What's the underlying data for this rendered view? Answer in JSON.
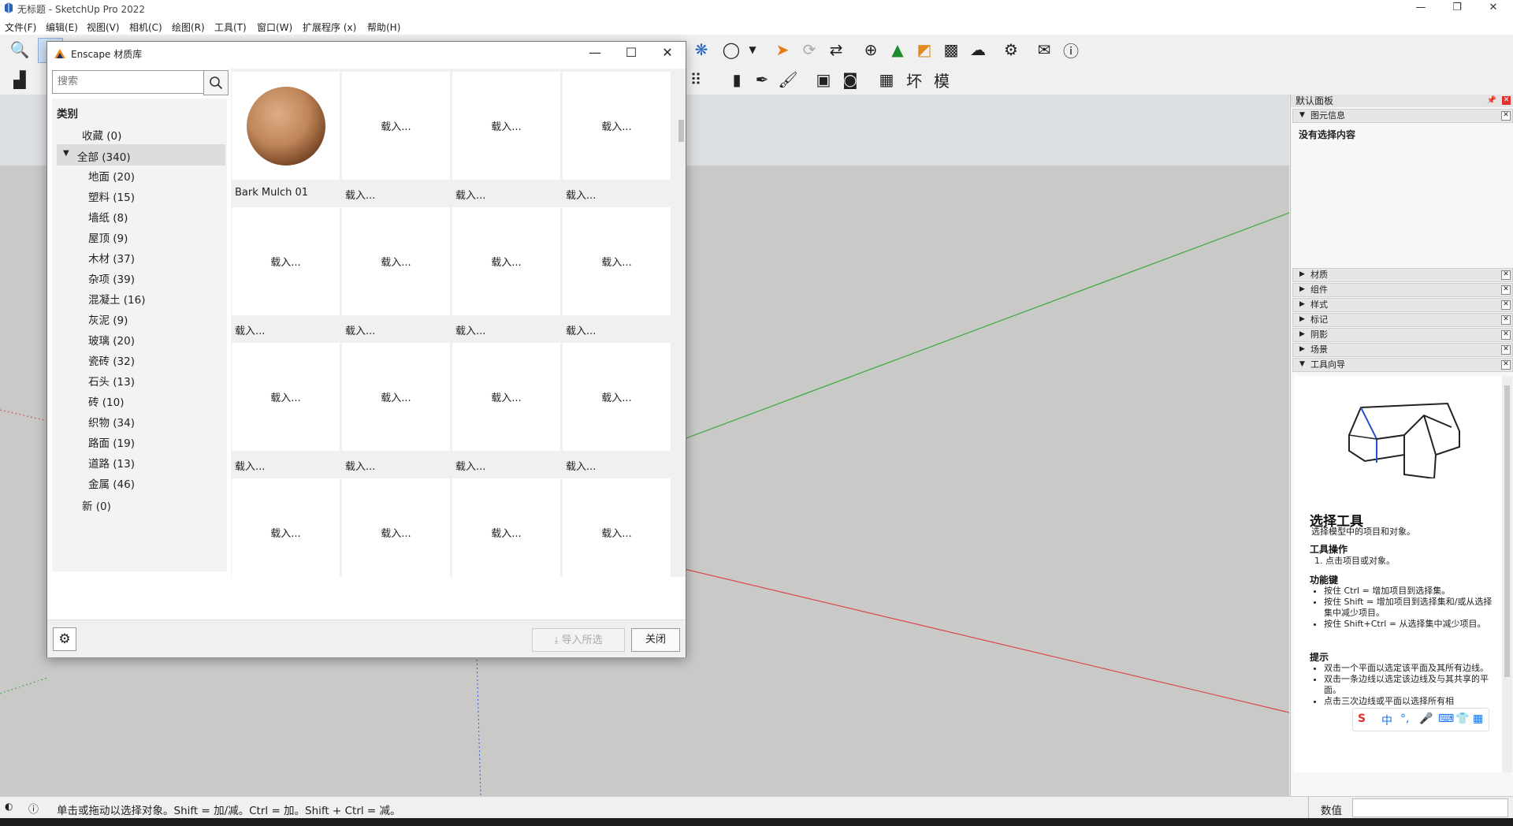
{
  "app": {
    "title": "无标题 - SketchUp Pro 2022",
    "window_controls": {
      "minimize": "—",
      "restore": "❐",
      "close": "✕"
    }
  },
  "menu": [
    "文件(F)",
    "编辑(E)",
    "视图(V)",
    "相机(C)",
    "绘图(R)",
    "工具(T)",
    "窗口(W)",
    "扩展程序 (x)",
    "帮助(H)"
  ],
  "dialog": {
    "title": "Enscape 材质库",
    "search_placeholder": "搜索",
    "categories_header": "类别",
    "favorites": "收藏 (0)",
    "all": "全部 (340)",
    "subcategories": [
      "地面 (20)",
      "塑料 (15)",
      "墙纸 (8)",
      "屋顶 (9)",
      "木材 (37)",
      "杂项 (39)",
      "混凝土 (16)",
      "灰泥 (9)",
      "玻璃 (20)",
      "瓷砖 (32)",
      "石头 (13)",
      "砖 (10)",
      "织物 (34)",
      "路面 (19)",
      "道路 (13)",
      "金属 (46)"
    ],
    "new": "新 (0)",
    "first_material": "Bark Mulch 01",
    "loading": "载入...",
    "import_button": "导入所选",
    "close_button": "关闭",
    "controls": {
      "minimize": "—",
      "maximize": "☐",
      "close": "✕"
    }
  },
  "tray": {
    "title": "默认面板",
    "entity_info": {
      "label": "图元信息",
      "content": "没有选择内容"
    },
    "panels": [
      "材质",
      "组件",
      "样式",
      "标记",
      "阴影",
      "场景",
      "工具向导"
    ],
    "instructor": {
      "tool_title": "选择工具",
      "tool_desc": "选择模型中的项目和对象。",
      "ops_header": "工具操作",
      "ops": [
        "1. 点击项目或对象。"
      ],
      "keys_header": "功能键",
      "keys": [
        "按住 Ctrl = 增加项目到选择集。",
        "按住 Shift = 增加项目到选择集和/或从选择集中减少项目。",
        "按住 Shift+Ctrl = 从选择集中减少项目。"
      ],
      "tips_header": "提示",
      "tips": [
        "双击一个平面以选定该平面及其所有边线。",
        "双击一条边线以选定该边线及与其共享的平面。",
        "点击三次边线或平面以选择所有相"
      ]
    }
  },
  "status": {
    "message": "单击或拖动以选择对象。Shift = 加/减。Ctrl = 加。Shift + Ctrl = 减。",
    "measure_label": "数值",
    "measure_value": ""
  },
  "ime": [
    "S",
    "中",
    "°,",
    "🎤",
    "⌨",
    "👕",
    "▦"
  ],
  "colors": {
    "green_axis": "#3aa83a",
    "red_axis": "#d9484c",
    "blue_axis": "#3a5ad9",
    "ground": "#c9c9c7",
    "sky": "#dcdfe2"
  }
}
